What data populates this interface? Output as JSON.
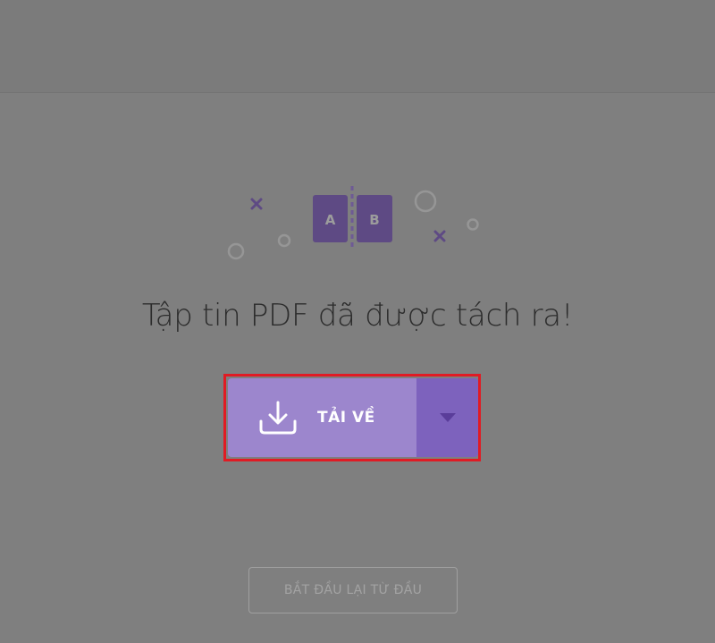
{
  "result": {
    "title": "Tập tin PDF đã được tách ra!"
  },
  "illustration": {
    "left_letter": "A",
    "right_letter": "B",
    "page_color": "#5e4a84",
    "accent_color": "#6e5a95",
    "ring_color": "#969696"
  },
  "download": {
    "label": "TẢI VỀ",
    "main_color": "#9c86cd",
    "toggle_color": "#7d62bd",
    "icon": "download-icon",
    "toggle_icon": "caret-down-icon"
  },
  "restart": {
    "label": "BẮT ĐẦU LẠI TỪ ĐẦU"
  },
  "highlight_color": "#e01b24"
}
